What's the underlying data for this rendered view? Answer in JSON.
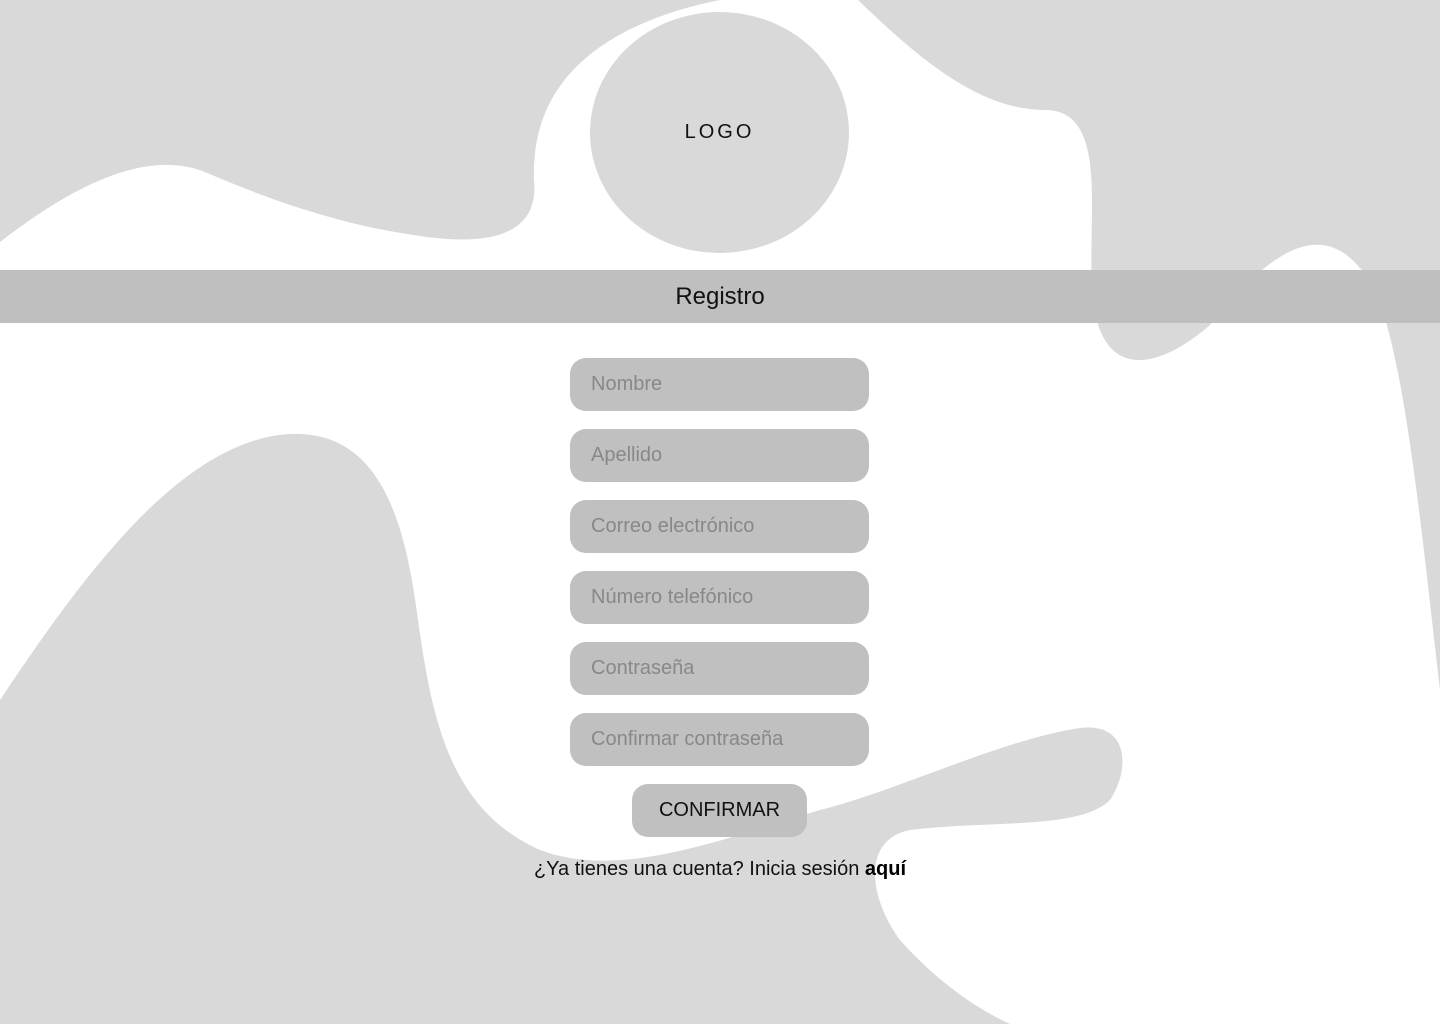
{
  "logo": {
    "label": "LOGO"
  },
  "page_title": "Registro",
  "form": {
    "fields": [
      {
        "placeholder": "Nombre",
        "value": ""
      },
      {
        "placeholder": "Apellido",
        "value": ""
      },
      {
        "placeholder": "Correo electrónico",
        "value": ""
      },
      {
        "placeholder": "Número telefónico",
        "value": ""
      },
      {
        "placeholder": "Contraseña",
        "value": ""
      },
      {
        "placeholder": "Confirmar contraseña",
        "value": ""
      }
    ],
    "confirm_label": "CONFIRMAR"
  },
  "login_prompt": {
    "text": "¿Ya tienes una cuenta? Inicia sesión",
    "link_label": "aquí"
  },
  "colors": {
    "background": "#ffffff",
    "shape_gray": "#d9d9d9",
    "field_gray": "#c0c0c0",
    "band_gray": "#bfbfbf",
    "placeholder_gray": "#888888",
    "text": "#111111"
  }
}
